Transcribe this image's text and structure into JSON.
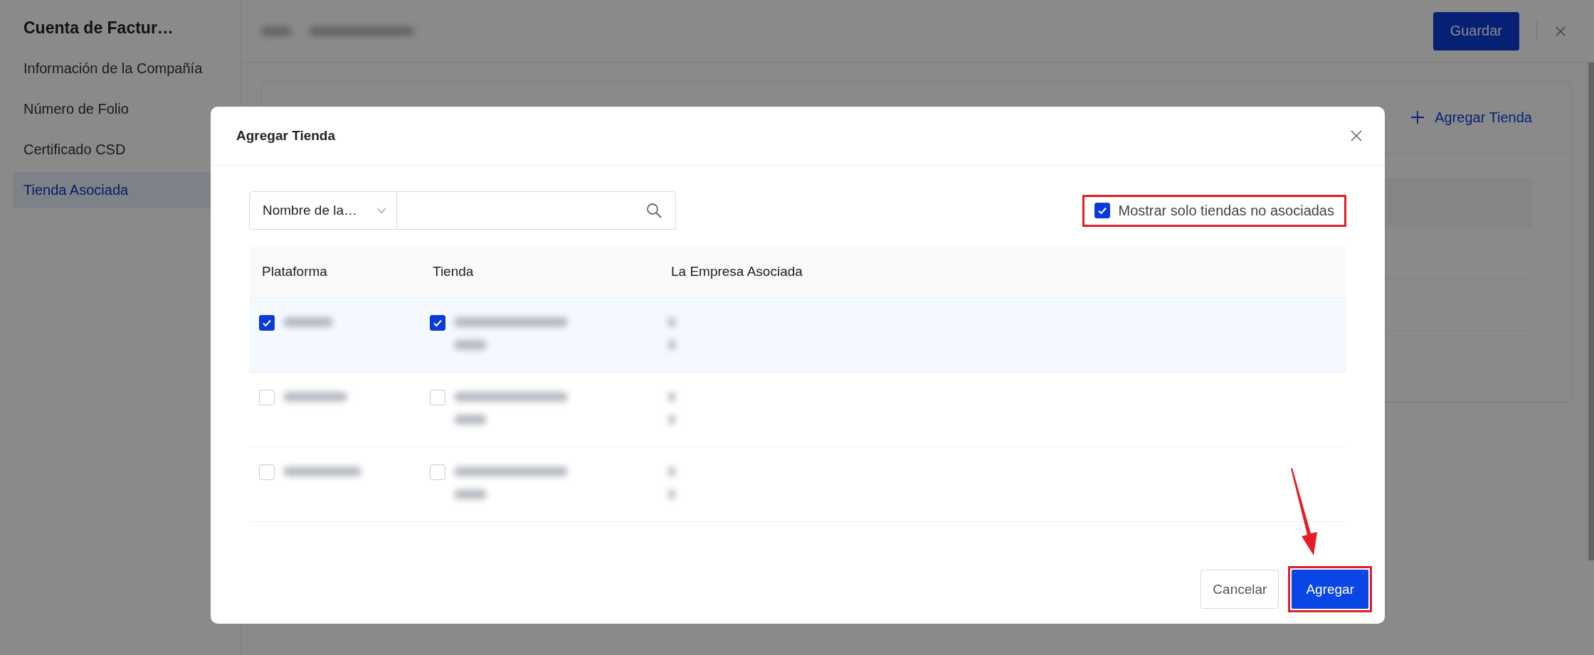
{
  "sidebar": {
    "title": "Cuenta de Factur…",
    "items": [
      {
        "label": "Información de la Compañía",
        "selected": false
      },
      {
        "label": "Número de Folio",
        "selected": false
      },
      {
        "label": "Certificado CSD",
        "selected": false
      },
      {
        "label": "Tienda Asociada",
        "selected": true
      }
    ]
  },
  "header": {
    "save_button": "Guardar"
  },
  "card": {
    "add_link": "Agregar Tienda"
  },
  "dialog": {
    "title": "Agregar Tienda",
    "search": {
      "filter": "Nombre de la…"
    },
    "only_unlinked": {
      "label": "Mostrar solo tiendas no asociadas",
      "checked": true
    },
    "table": {
      "columns": [
        "Plataforma",
        "Tienda",
        "La Empresa Asociada"
      ],
      "rows": [
        {
          "platform_checked": true,
          "store_checked": true
        },
        {
          "platform_checked": false,
          "store_checked": false
        },
        {
          "platform_checked": false,
          "store_checked": false
        }
      ]
    },
    "buttons": {
      "cancel": "Cancelar",
      "confirm": "Agregar"
    }
  }
}
